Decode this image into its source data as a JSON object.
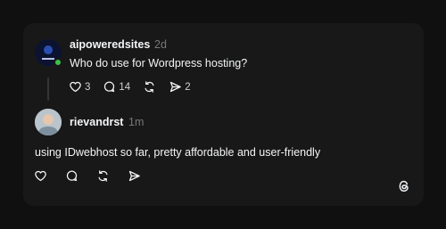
{
  "post": {
    "username": "aipoweredsites",
    "time": "2d",
    "text": "Who do use for Wordpress hosting?",
    "likes": "3",
    "replies": "14",
    "shares": "2"
  },
  "reply": {
    "username": "rievandrst",
    "time": "1m",
    "text": "using IDwebhost so far, pretty affordable and user-friendly"
  },
  "icons": {
    "like": "heart-icon",
    "reply": "comment-icon",
    "repost": "repost-icon",
    "share": "send-icon",
    "logo": "threads-logo-icon"
  },
  "colors": {
    "background": "#101010",
    "card": "#181818",
    "online": "#3ac34a",
    "muted": "#777777"
  }
}
